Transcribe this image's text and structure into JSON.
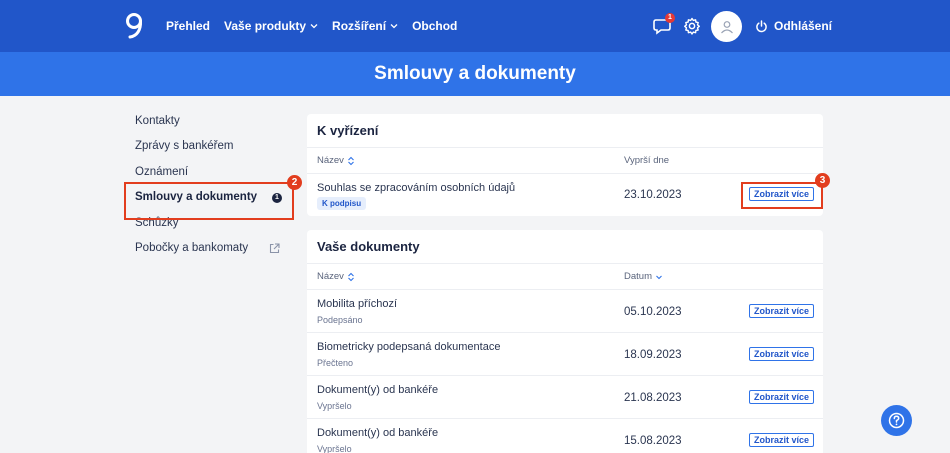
{
  "header": {
    "nav": [
      {
        "label": "Přehled",
        "dropdown": false
      },
      {
        "label": "Vaše produkty",
        "dropdown": true
      },
      {
        "label": "Rozšíření",
        "dropdown": true
      },
      {
        "label": "Obchod",
        "dropdown": false
      }
    ],
    "messages_badge": "1",
    "logout_label": "Odhlášení"
  },
  "page": {
    "title": "Smlouvy a dokumenty"
  },
  "sidebar": {
    "items": [
      {
        "label": "Kontakty"
      },
      {
        "label": "Zprávy s bankéřem"
      },
      {
        "label": "Oznámení"
      },
      {
        "label": "Smlouvy a dokumenty",
        "active": true,
        "badge": "1"
      },
      {
        "label": "Schůzky"
      },
      {
        "label": "Pobočky a bankomaty",
        "external": true
      }
    ]
  },
  "markers": {
    "sidebar": "2",
    "button": "3"
  },
  "pending": {
    "title": "K vyřízení",
    "col_name": "Název",
    "col_date": "Vyprší dne",
    "rows": [
      {
        "name": "Souhlas se zpracováním osobních údajů",
        "tag": "K podpisu",
        "date": "23.10.2023",
        "action": "Zobrazit více"
      }
    ]
  },
  "documents": {
    "title": "Vaše dokumenty",
    "col_name": "Název",
    "col_date": "Datum",
    "rows": [
      {
        "name": "Mobilita příchozí",
        "status": "Podepsáno",
        "date": "05.10.2023",
        "action": "Zobrazit více"
      },
      {
        "name": "Biometricky podepsaná dokumentace",
        "status": "Přečteno",
        "date": "18.09.2023",
        "action": "Zobrazit více"
      },
      {
        "name": "Dokument(y) od bankéře",
        "status": "Vypršelo",
        "date": "21.08.2023",
        "action": "Zobrazit více"
      },
      {
        "name": "Dokument(y) od bankéře",
        "status": "Vypršelo",
        "date": "15.08.2023",
        "action": "Zobrazit více"
      }
    ]
  },
  "colors": {
    "header": "#2156c9",
    "hero": "#2f73e8",
    "highlight": "#e23d1e",
    "text": "#1b2440"
  },
  "icons": [
    "logo-icon",
    "chevron-down-icon",
    "message-icon",
    "gear-icon",
    "user-icon",
    "power-icon",
    "sort-icon",
    "external-link-icon",
    "help-icon"
  ]
}
